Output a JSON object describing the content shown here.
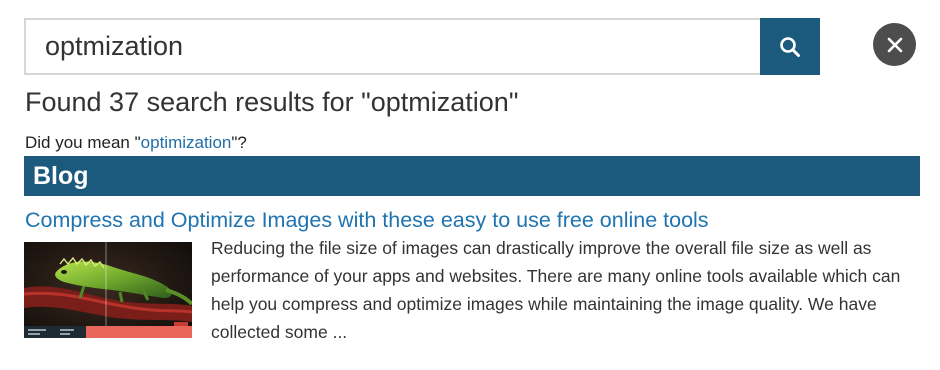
{
  "search": {
    "query": "optmization",
    "search_button_icon": "search-icon",
    "close_button_icon": "close-icon"
  },
  "summary": {
    "results_text": "Found 37 search results for \"optmization\"",
    "did_you_mean_prefix": "Did you mean \"",
    "did_you_mean_suggestion": "optimization",
    "did_you_mean_suffix": "\"?"
  },
  "section": {
    "title": "Blog"
  },
  "results": [
    {
      "title": "Compress and Optimize Images with these easy to use free online tools",
      "thumbnail": "iguana-thumbnail",
      "snippet": "Reducing the file size of images can drastically improve the overall file size as well as performance of your apps and websites. There are many online tools available which can help you compress and optimize images while maintaining the image quality. We have collected some ..."
    }
  ],
  "colors": {
    "accent": "#1c5a7d",
    "link": "#1f74b0",
    "close_button": "#4d4d4d"
  }
}
